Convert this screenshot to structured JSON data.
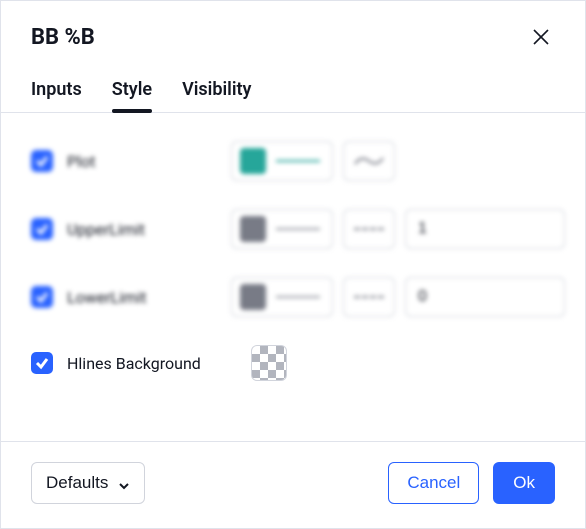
{
  "title": "BB %B",
  "tabs": {
    "inputs": "Inputs",
    "style": "Style",
    "visibility": "Visibility",
    "active": "style"
  },
  "rows": {
    "plot": {
      "label": "Plot",
      "checked": true,
      "swatch_color": "#26a69a",
      "line_color": "#26a69a",
      "line_dashed": false
    },
    "upper": {
      "label": "UpperLimit",
      "checked": true,
      "swatch_color": "#787b86",
      "line_color": "#9598a1",
      "value": "1"
    },
    "lower": {
      "label": "LowerLimit",
      "checked": true,
      "swatch_color": "#787b86",
      "line_color": "#9598a1",
      "value": "0"
    },
    "hlines": {
      "label": "Hlines Background",
      "checked": true
    }
  },
  "footer": {
    "defaults": "Defaults",
    "cancel": "Cancel",
    "ok": "Ok"
  }
}
